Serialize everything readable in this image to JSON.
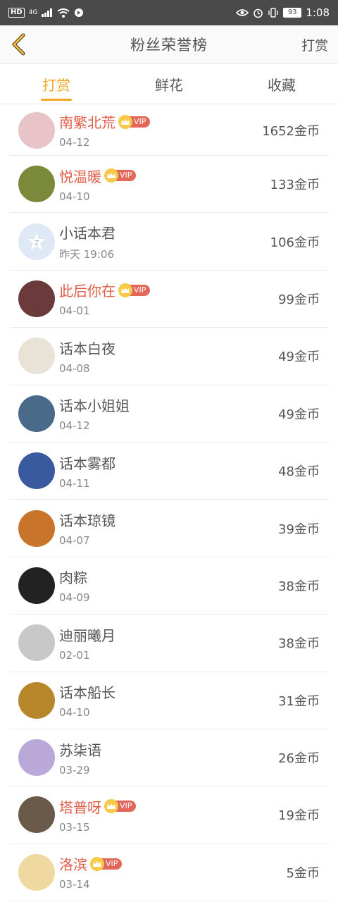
{
  "status_bar": {
    "hd": "HD",
    "network": "4G",
    "battery": "93",
    "time": "1:08"
  },
  "header": {
    "title": "粉丝荣誉榜",
    "action": "打赏"
  },
  "tabs": [
    {
      "label": "打赏",
      "active": true
    },
    {
      "label": "鲜花",
      "active": false
    },
    {
      "label": "收藏",
      "active": false
    }
  ],
  "rows": [
    {
      "name": "南繁北荒",
      "date": "04-12",
      "coins": "1652金币",
      "vip": true
    },
    {
      "name": "悦温暖",
      "date": "04-10",
      "coins": "133金币",
      "vip": true
    },
    {
      "name": "小话本君",
      "date": "昨天 19:06",
      "coins": "106金币",
      "vip": false
    },
    {
      "name": "此后你在",
      "date": "04-01",
      "coins": "99金币",
      "vip": true
    },
    {
      "name": "话本白夜",
      "date": "04-08",
      "coins": "49金币",
      "vip": false
    },
    {
      "name": "话本小姐姐",
      "date": "04-12",
      "coins": "49金币",
      "vip": false
    },
    {
      "name": "话本雾都",
      "date": "04-11",
      "coins": "48金币",
      "vip": false
    },
    {
      "name": "话本琼镜",
      "date": "04-07",
      "coins": "39金币",
      "vip": false
    },
    {
      "name": "肉粽",
      "date": "04-09",
      "coins": "38金币",
      "vip": false
    },
    {
      "name": "迪丽曦月",
      "date": "02-01",
      "coins": "38金币",
      "vip": false
    },
    {
      "name": "话本船长",
      "date": "04-10",
      "coins": "31金币",
      "vip": false
    },
    {
      "name": "苏柒语",
      "date": "03-29",
      "coins": "26金币",
      "vip": false
    },
    {
      "name": "塔普呀",
      "date": "03-15",
      "coins": "19金币",
      "vip": true
    },
    {
      "name": "洛滨",
      "date": "03-14",
      "coins": "5金币",
      "vip": true
    }
  ],
  "vip_label": "VIP",
  "colors": {
    "accent": "#f5a623",
    "vip_name": "#e25b45",
    "vip_tag": "#e2675a"
  }
}
